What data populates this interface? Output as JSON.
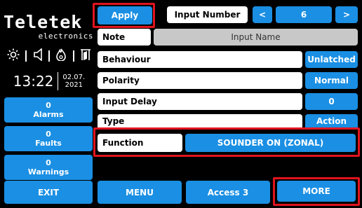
{
  "brand": {
    "name": "Teletek",
    "sub": "electronics"
  },
  "status_icons": [
    "sun-icon",
    "speaker-icon",
    "flame-icon",
    "door-icon"
  ],
  "clock": {
    "time": "13:22",
    "date_line1": "02.07.",
    "date_line2": "2021"
  },
  "side": {
    "alarms": {
      "count": "0",
      "label": "Alarms"
    },
    "faults": {
      "count": "0",
      "label": "Faults"
    },
    "warnings": {
      "count": "0",
      "label": "Warnings"
    }
  },
  "topbar": {
    "apply": "Apply",
    "input_number_label": "Input Number",
    "prev": "<",
    "value": "6",
    "next": ">"
  },
  "rows": {
    "note": {
      "label": "Note",
      "value": "Input Name"
    },
    "behaviour": {
      "label": "Behaviour",
      "value": "Unlatched"
    },
    "polarity": {
      "label": "Polarity",
      "value": "Normal"
    },
    "input_delay": {
      "label": "Input Delay",
      "value": "0"
    },
    "type": {
      "label": "Type",
      "value": "Action"
    },
    "function": {
      "label": "Function",
      "value": "SOUNDER ON (ZONAL)"
    }
  },
  "bottom": {
    "exit": "EXIT",
    "menu": "MENU",
    "access": "Access 3",
    "more": "MORE"
  },
  "colors": {
    "accent": "#1a8fe3",
    "highlight": "#e0141e",
    "background": "#000000"
  }
}
